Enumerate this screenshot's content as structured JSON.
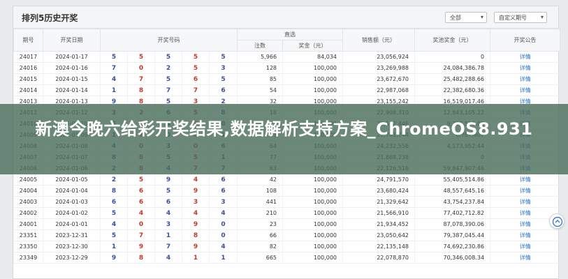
{
  "banner": {
    "text": "新澳今晚六给彩开奖结果,数据解析支持方案_ChromeOS8.931"
  },
  "panel": {
    "title": "排列5历史开奖",
    "filter_all": "全部",
    "filter_custom": "自定义期号"
  },
  "table": {
    "headers": {
      "issue": "期号",
      "date": "开奖日期",
      "numbers": "开奖号码",
      "direct": "直选",
      "bets": "注数",
      "prize": "奖金（元）",
      "sales": "销售额（元）",
      "pool": "奖池奖金（元）",
      "notice": "开奖公告"
    },
    "rows": [
      {
        "issue": "24017",
        "date": "2024-01-17",
        "n": [
          "5",
          "5",
          "5",
          "5",
          "5"
        ],
        "bets": "5,966",
        "prize": "84,034",
        "sales": "23,056,924",
        "pool": "0",
        "notice": "详情"
      },
      {
        "issue": "24016",
        "date": "2024-01-16",
        "n": [
          "7",
          "0",
          "2",
          "5",
          "3"
        ],
        "bets": "128",
        "prize": "100,000",
        "sales": "23,269,988",
        "pool": "24,084,386.78",
        "notice": "详情"
      },
      {
        "issue": "24015",
        "date": "2024-01-15",
        "n": [
          "4",
          "7",
          "5",
          "6",
          "5"
        ],
        "bets": "85",
        "prize": "100,000",
        "sales": "23,672,670",
        "pool": "25,482,288.66",
        "notice": "详情"
      },
      {
        "issue": "24014",
        "date": "2024-01-14",
        "n": [
          "1",
          "8",
          "7",
          "7",
          "6"
        ],
        "bets": "54",
        "prize": "100,000",
        "sales": "22,987,068",
        "pool": "22,382,680.36",
        "notice": "详情"
      },
      {
        "issue": "24013",
        "date": "2024-01-13",
        "n": [
          "9",
          "8",
          "5",
          "3",
          "2"
        ],
        "bets": "32",
        "prize": "100,000",
        "sales": "23,155,242",
        "pool": "16,519,017.46",
        "notice": "详情"
      },
      {
        "issue": "24012",
        "date": "2024-01-12",
        "n": [
          "3",
          "2",
          "6",
          "5",
          "8"
        ],
        "bets": "18",
        "prize": "100,000",
        "sales": "22,908,310",
        "pool": "12,843,105.22",
        "notice": "详情"
      },
      {
        "issue": "24010",
        "date": "2024-01-10",
        "n": [
          "6",
          "1",
          "4",
          "9",
          "0"
        ],
        "bets": "47",
        "prize": "100,000",
        "sales": "23,512,446",
        "pool": "9,217,553.08",
        "notice": "详情"
      },
      {
        "issue": "24009",
        "date": "2024-01-09",
        "n": [
          "1",
          "8",
          "0",
          "8",
          "1"
        ],
        "bets": "23",
        "prize": "100,000",
        "sales": "23,701,744",
        "pool": "6,787,807",
        "notice": "详情"
      },
      {
        "issue": "24008",
        "date": "2024-01-08",
        "n": [
          "4",
          "0",
          "3",
          "0",
          "6"
        ],
        "bets": "64",
        "prize": "100,000",
        "sales": "24,232,556",
        "pool": "4,173,952.44",
        "notice": "详情"
      },
      {
        "issue": "24007",
        "date": "2024-01-07",
        "n": [
          "8",
          "8",
          "5",
          "5",
          "1"
        ],
        "bets": "77",
        "prize": "100,000",
        "sales": "21,868,238",
        "pool": "0",
        "notice": "详情"
      },
      {
        "issue": "24006",
        "date": "2024-01-06",
        "n": [
          "2",
          "8",
          "4",
          "7",
          "7"
        ],
        "bets": "63",
        "prize": "100,000",
        "sales": "22,126,516",
        "pool": "59,947,907.46",
        "notice": "详情"
      },
      {
        "issue": "24005",
        "date": "2024-01-05",
        "n": [
          "2",
          "5",
          "9",
          "4",
          "6"
        ],
        "bets": "42",
        "prize": "100,000",
        "sales": "24,791,570",
        "pool": "55,405,514.86",
        "notice": "详情"
      },
      {
        "issue": "24004",
        "date": "2024-01-04",
        "n": [
          "8",
          "6",
          "5",
          "9",
          "6"
        ],
        "bets": "108",
        "prize": "100,000",
        "sales": "23,680,424",
        "pool": "48,557,645.16",
        "notice": "详情"
      },
      {
        "issue": "24003",
        "date": "2024-01-03",
        "n": [
          "6",
          "6",
          "6",
          "3",
          "3"
        ],
        "bets": "441",
        "prize": "100,000",
        "sales": "21,329,642",
        "pool": "43,754,237.84",
        "notice": "详情"
      },
      {
        "issue": "24002",
        "date": "2024-01-02",
        "n": [
          "5",
          "4",
          "4",
          "4",
          "4"
        ],
        "bets": "210",
        "prize": "100,000",
        "sales": "21,566,910",
        "pool": "77,402,712.82",
        "notice": "详情"
      },
      {
        "issue": "24001",
        "date": "2024-01-01",
        "n": [
          "4",
          "0",
          "3",
          "9",
          "0"
        ],
        "bets": "23",
        "prize": "100,000",
        "sales": "21,934,452",
        "pool": "87,078,390.06",
        "notice": "详情"
      },
      {
        "issue": "23351",
        "date": "2023-12-31",
        "n": [
          "5",
          "7",
          "1",
          "8",
          "0"
        ],
        "bets": "66",
        "prize": "100,000",
        "sales": "23,050,642",
        "pool": "79,387,045.44",
        "notice": "详情"
      },
      {
        "issue": "23350",
        "date": "2023-12-30",
        "n": [
          "1",
          "9",
          "7",
          "9",
          "4"
        ],
        "bets": "82",
        "prize": "100,000",
        "sales": "22,135,148",
        "pool": "74,692,230.86",
        "notice": "详情"
      },
      {
        "issue": "23349",
        "date": "2023-12-29",
        "n": [
          "9",
          "8",
          "4",
          "1",
          "1"
        ],
        "bets": "665",
        "prize": "100,000",
        "sales": "22,078,870",
        "pool": "70,346,008.34",
        "notice": "详情"
      }
    ]
  },
  "colors": {
    "number_red": "#c0392b",
    "number_blue": "#3a4fa3",
    "link": "#2a6fd6",
    "banner_bg": "#4a6e5c"
  }
}
